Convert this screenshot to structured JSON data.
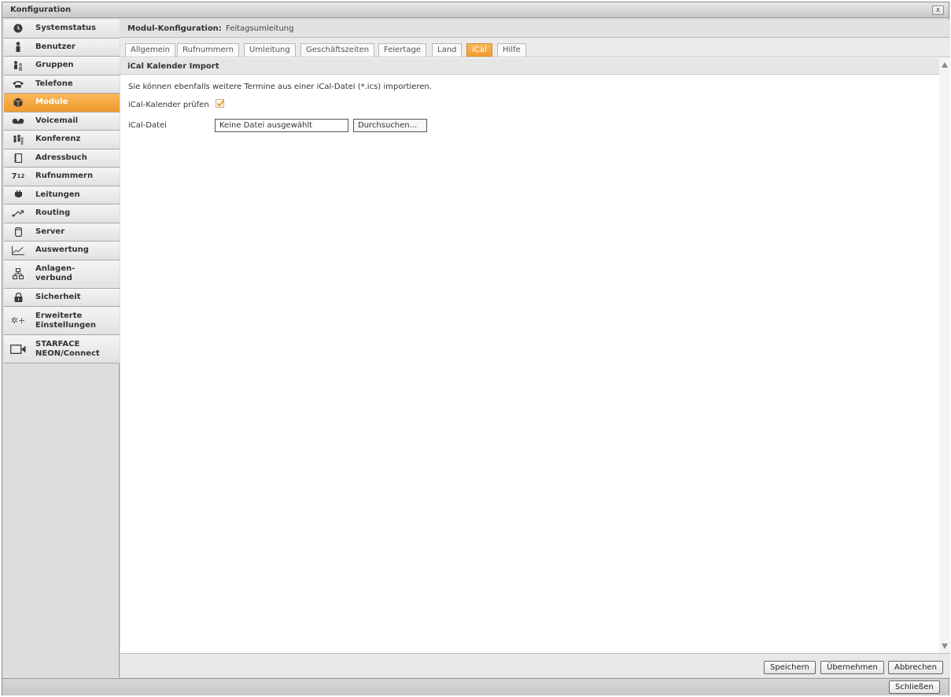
{
  "window": {
    "title": "Konfiguration",
    "close_label": "x"
  },
  "sidebar": {
    "items": [
      {
        "label": "Systemstatus",
        "icon": "clock-icon"
      },
      {
        "label": "Benutzer",
        "icon": "user-icon"
      },
      {
        "label": "Gruppen",
        "icon": "group-icon"
      },
      {
        "label": "Telefone",
        "icon": "phone-icon"
      },
      {
        "label": "Module",
        "icon": "module-icon",
        "active": true
      },
      {
        "label": "Voicemail",
        "icon": "voicemail-icon"
      },
      {
        "label": "Konferenz",
        "icon": "conference-icon"
      },
      {
        "label": "Adressbuch",
        "icon": "addressbook-icon"
      },
      {
        "label": "Rufnummern",
        "icon": "numbers-icon"
      },
      {
        "label": "Leitungen",
        "icon": "line-icon"
      },
      {
        "label": "Routing",
        "icon": "routing-icon"
      },
      {
        "label": "Server",
        "icon": "server-icon"
      },
      {
        "label": "Auswertung",
        "icon": "chart-icon"
      },
      {
        "label": "Anlagen-\nverbund",
        "icon": "network-icon"
      },
      {
        "label": "Sicherheit",
        "icon": "lock-icon"
      },
      {
        "label": "Erweiterte\nEinstellungen",
        "icon": "gear-plus-icon"
      },
      {
        "label": "STARFACE\nNEON/Connect",
        "icon": "camera-icon"
      }
    ]
  },
  "main": {
    "module_header": {
      "title": "Modul-Konfiguration:",
      "value": "Feitagsumleitung"
    },
    "tabs": [
      {
        "label": "Allgemein"
      },
      {
        "label": "Rufnummern"
      },
      {
        "label": "Umleitung"
      },
      {
        "label": "Geschäftszeiten"
      },
      {
        "label": "Feiertage"
      },
      {
        "label": "Land"
      },
      {
        "label": "iCal",
        "active": true
      },
      {
        "label": "Hilfe"
      }
    ],
    "section_title": "iCal Kalender Import",
    "description": "Sie können ebenfalls weitere Termine aus einer iCal-Datei (*.ics) importieren.",
    "check_label": "iCal-Kalender prüfen",
    "check_value": true,
    "file_label": "iCal-Datei",
    "file_value": "Keine Datei ausgewählt",
    "browse_label": "Durchsuchen..."
  },
  "footer": {
    "save_label": "Speichern",
    "apply_label": "Übernehmen",
    "cancel_label": "Abbrechen"
  },
  "bottombar": {
    "close_label": "Schließen"
  },
  "colors": {
    "accent": "#f09a2c",
    "check": "#e8932a"
  }
}
